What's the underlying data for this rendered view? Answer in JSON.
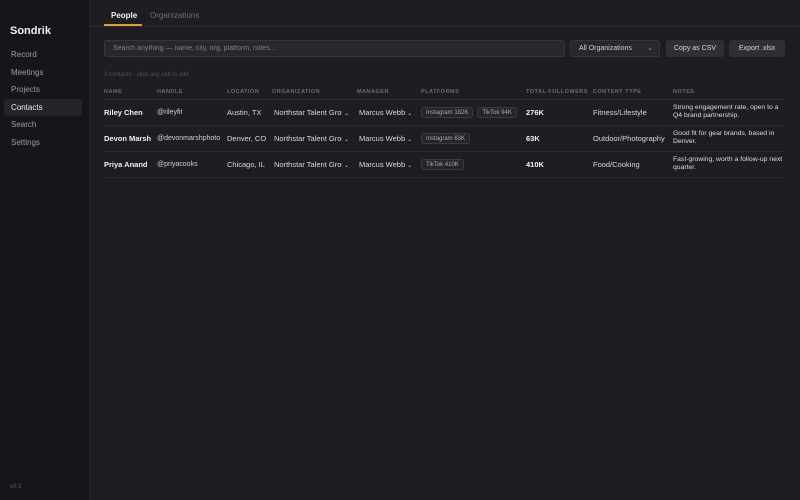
{
  "app": {
    "name": "Sondrik",
    "version": "v0.3"
  },
  "sidebar": {
    "items": [
      {
        "label": "Record"
      },
      {
        "label": "Meetings"
      },
      {
        "label": "Projects"
      },
      {
        "label": "Contacts",
        "active": true
      },
      {
        "label": "Search"
      },
      {
        "label": "Settings"
      }
    ]
  },
  "tabs": [
    {
      "label": "People",
      "active": true
    },
    {
      "label": "Organizations"
    }
  ],
  "toolbar": {
    "search_placeholder": "Search anything — name, city, org, platform, notes...",
    "org_filter": "All Organizations",
    "csv_label": "Copy as CSV",
    "xlsx_label": "Export .xlsx"
  },
  "summary": "3 contacts · click any cell to edit",
  "columns": [
    "NAME",
    "HANDLE",
    "LOCATION",
    "ORGANIZATION",
    "MANAGER",
    "PLATFORMS",
    "TOTAL FOLLOWERS",
    "CONTENT TYPE",
    "NOTES"
  ],
  "rows": [
    {
      "name": "Riley Chen",
      "handle": "@rileyfit",
      "location": "Austin, TX",
      "organization": "Northstar Talent Group",
      "manager": "Marcus Webb",
      "platforms": [
        "Instagram 182K",
        "TikTok 94K"
      ],
      "followers": "276K",
      "content_type": "Fitness/Lifestyle",
      "notes": "Strong engagement rate, open to a Q4 brand partnership."
    },
    {
      "name": "Devon Marsh",
      "handle": "@devonmarshphoto",
      "location": "Denver, CO",
      "organization": "Northstar Talent Group",
      "manager": "Marcus Webb",
      "platforms": [
        "Instagram 63K"
      ],
      "followers": "63K",
      "content_type": "Outdoor/Photography",
      "notes": "Good fit for gear brands, based in Denver."
    },
    {
      "name": "Priya Anand",
      "handle": "@priyacooks",
      "location": "Chicago, IL",
      "organization": "Northstar Talent Group",
      "manager": "Marcus Webb",
      "platforms": [
        "TikTok 410K"
      ],
      "followers": "410K",
      "content_type": "Food/Cooking",
      "notes": "Fast-growing, worth a follow-up next quarter."
    }
  ],
  "colors": {
    "accent": "#e0a030",
    "background": "#1c1e22",
    "sidebar": "#151619"
  }
}
